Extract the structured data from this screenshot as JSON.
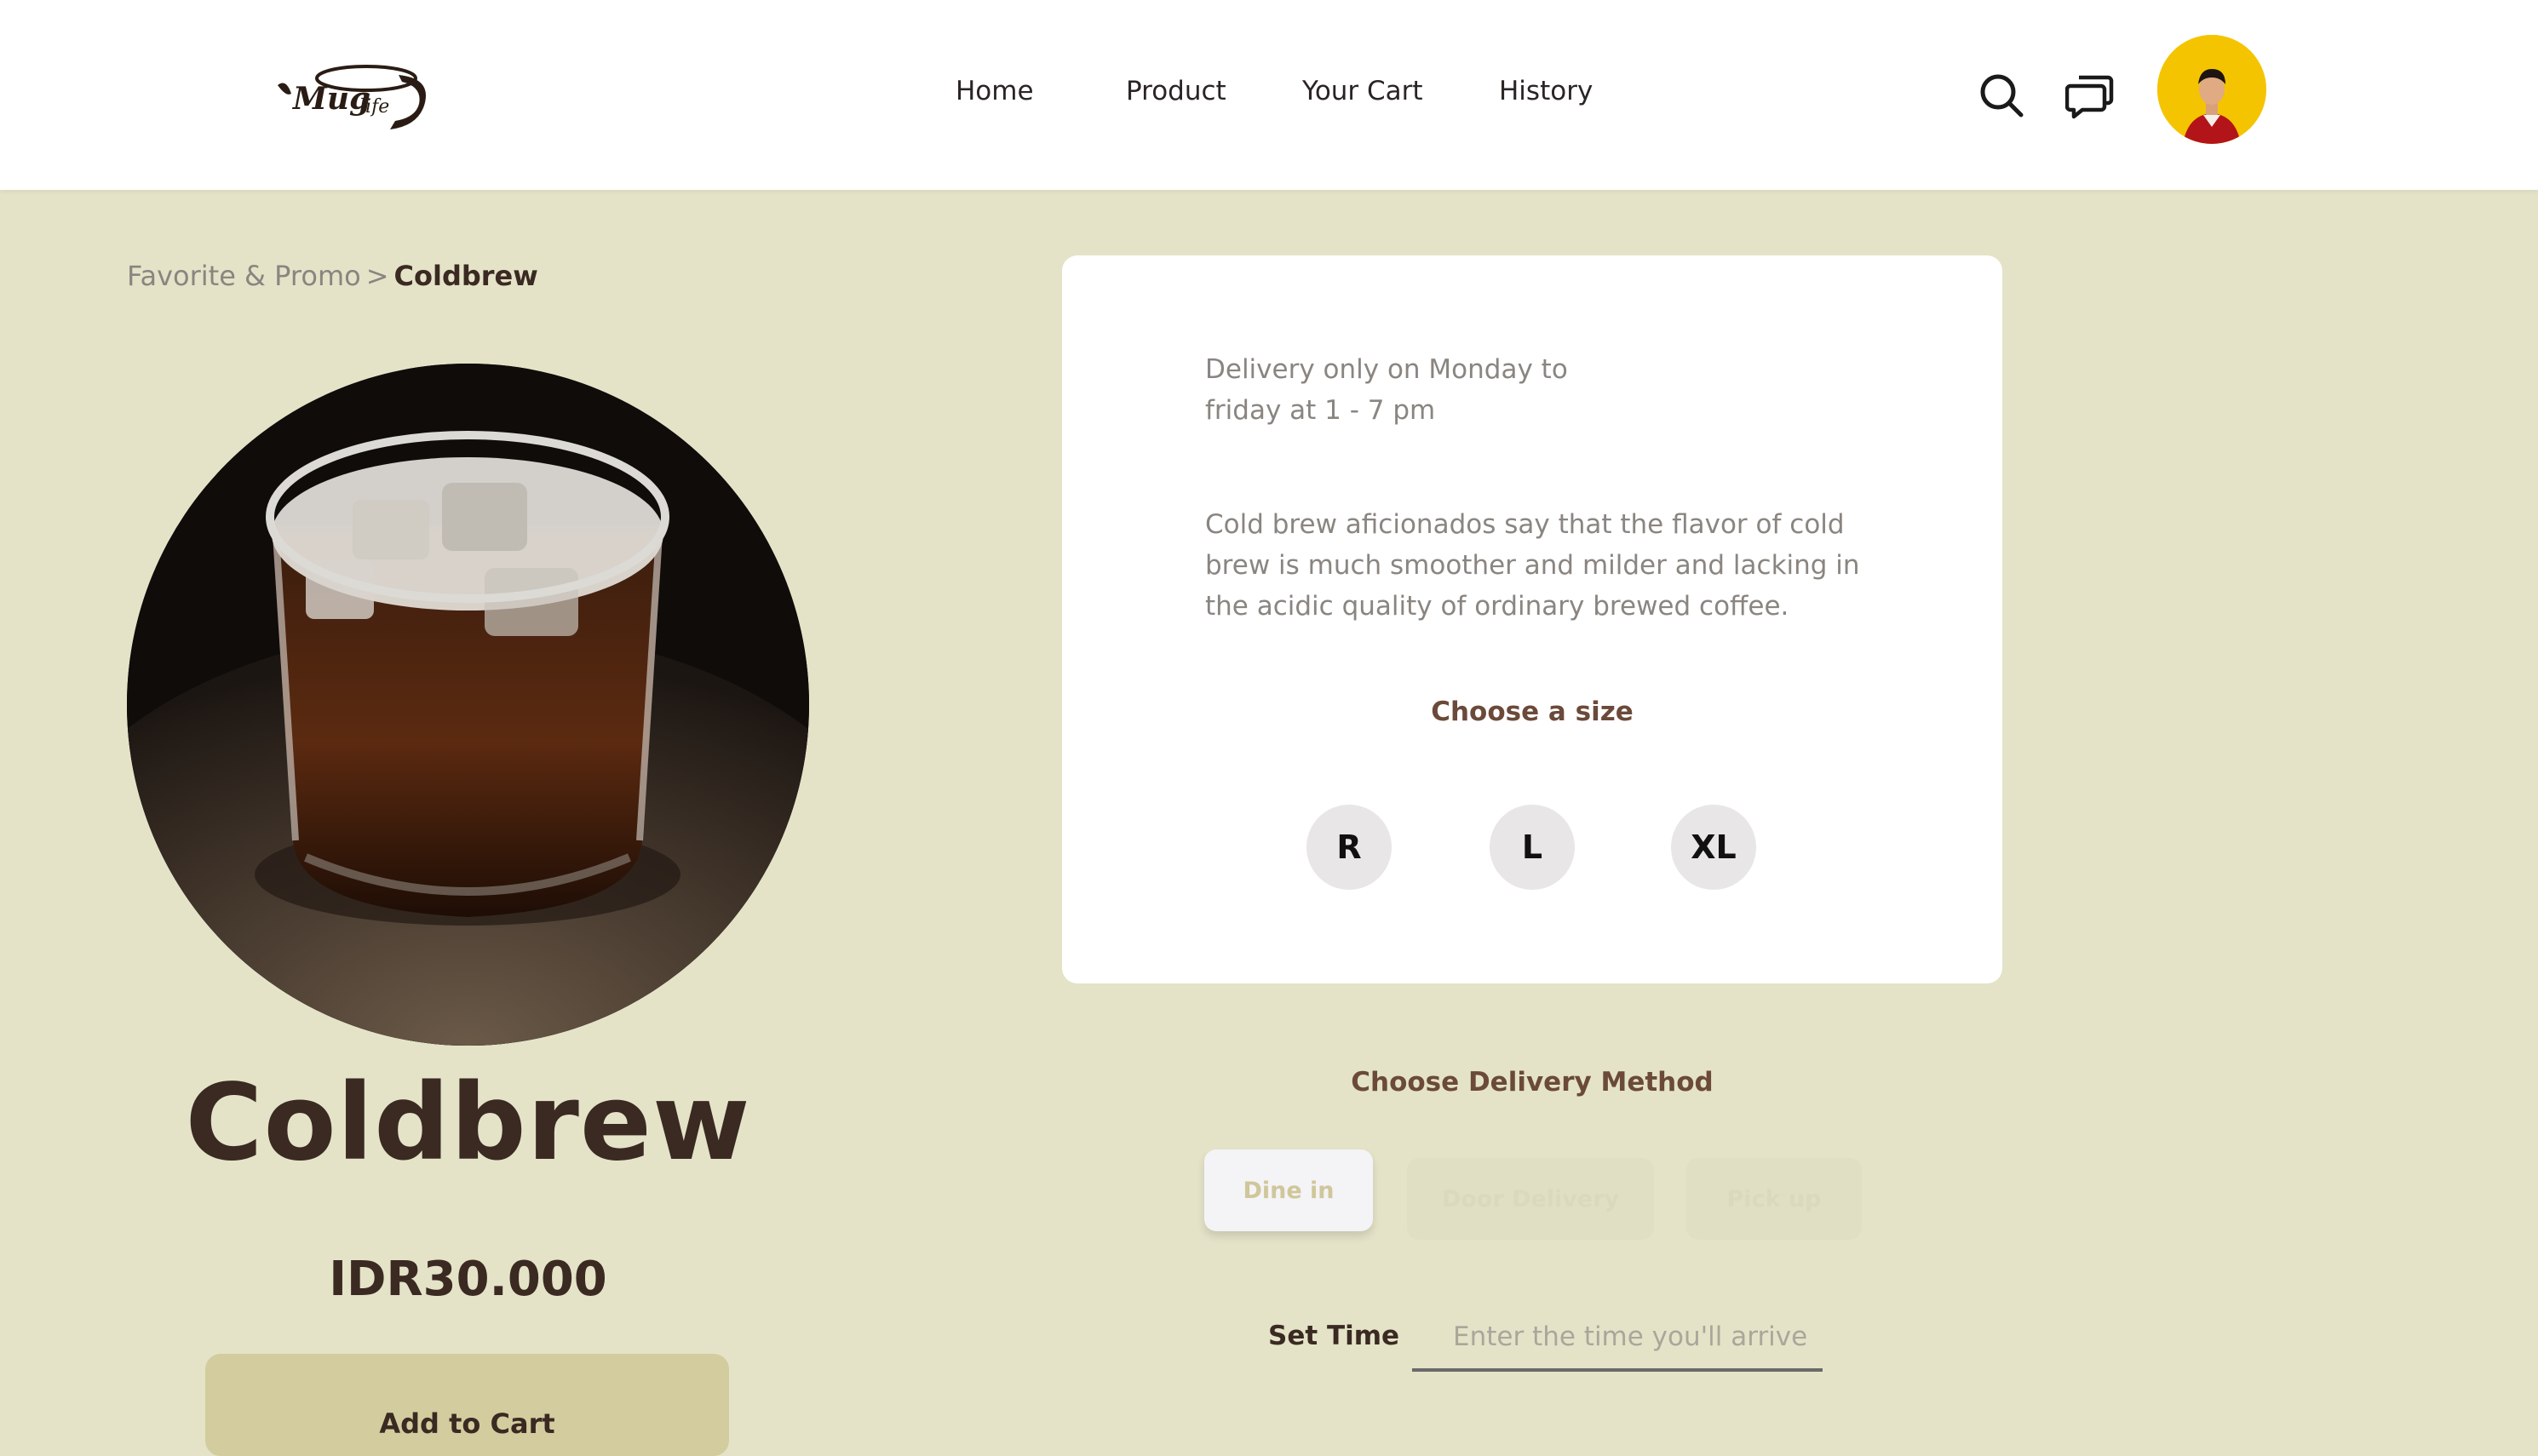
{
  "header": {
    "logo_text": "Mug life",
    "nav": [
      "Home",
      "Product",
      "Your Cart",
      "History"
    ],
    "icons": [
      "search-icon",
      "chat-icon"
    ],
    "avatar": "user-avatar"
  },
  "breadcrumb": {
    "parent": "Favorite & Promo",
    "separator": ">",
    "current": "Coldbrew"
  },
  "product": {
    "name": "Coldbrew",
    "price": "IDR30.000",
    "add_to_cart": "Add to Cart"
  },
  "info": {
    "delivery_note": "Delivery only on Monday to friday at 1 - 7 pm",
    "description": "Cold brew aficionados say that the flavor of cold brew is much smoother and milder and lacking in the acidic quality of ordinary brewed coffee.",
    "size_title": "Choose a size",
    "sizes": [
      "R",
      "L",
      "XL"
    ]
  },
  "delivery": {
    "title": "Choose Delivery Method",
    "methods": [
      "Dine in",
      "Door Delivery",
      "Pick up"
    ],
    "selected": "Dine in"
  },
  "set_time": {
    "label": "Set Time",
    "placeholder": "Enter the time you'll arrive"
  },
  "colors": {
    "background": "#e4e3c8",
    "brand_brown": "#3a2a22",
    "accent_tan": "#d3cc9e",
    "avatar_yellow": "#f5c400"
  }
}
